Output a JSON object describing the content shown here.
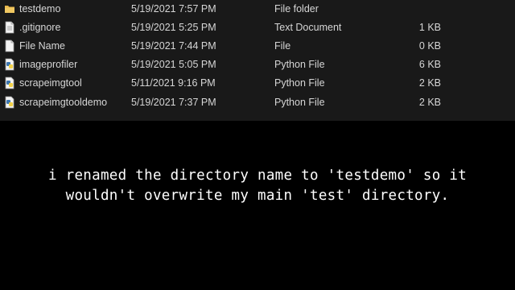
{
  "files": [
    {
      "name": "testdemo",
      "date": "5/19/2021 7:57 PM",
      "type": "File folder",
      "size": "",
      "icon": "folder-icon"
    },
    {
      "name": ".gitignore",
      "date": "5/19/2021 5:25 PM",
      "type": "Text Document",
      "size": "1 KB",
      "icon": "text-document-icon"
    },
    {
      "name": "File Name",
      "date": "5/19/2021 7:44 PM",
      "type": "File",
      "size": "0 KB",
      "icon": "file-icon"
    },
    {
      "name": "imageprofiler",
      "date": "5/19/2021 5:05 PM",
      "type": "Python File",
      "size": "6 KB",
      "icon": "python-file-icon"
    },
    {
      "name": "scrapeimgtool",
      "date": "5/11/2021 9:16 PM",
      "type": "Python File",
      "size": "2 KB",
      "icon": "python-file-icon"
    },
    {
      "name": "scrapeimgtooldemo",
      "date": "5/19/2021 7:37 PM",
      "type": "Python File",
      "size": "2 KB",
      "icon": "python-file-icon"
    }
  ],
  "caption": {
    "line1": "i renamed the directory name to 'testdemo' so it",
    "line2": "wouldn't overwrite my main 'test' directory."
  },
  "colors": {
    "explorer_bg": "#191919",
    "text": "#d6d6d6",
    "folder": "#e8b74c",
    "python_blue": "#3b75b0",
    "python_yellow": "#f2d24a",
    "caption_text": "#ffffff"
  }
}
